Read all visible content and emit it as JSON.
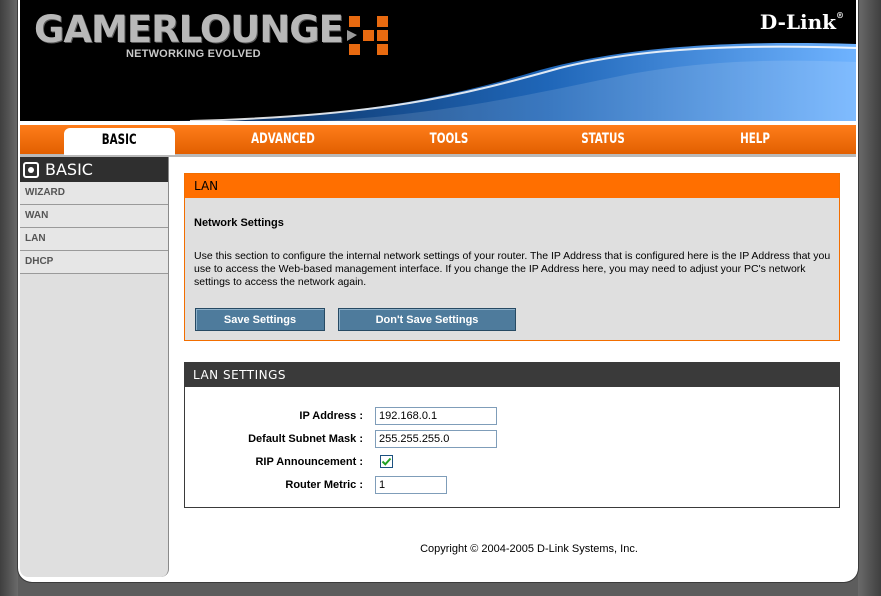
{
  "header": {
    "logo_main": "GAMERLOUNGE",
    "logo_sub": "NETWORKING EVOLVED",
    "brand": "D-Link"
  },
  "tabs": [
    {
      "label": "BASIC",
      "active": true
    },
    {
      "label": "ADVANCED",
      "active": false
    },
    {
      "label": "TOOLS",
      "active": false
    },
    {
      "label": "STATUS",
      "active": false
    },
    {
      "label": "HELP",
      "active": false
    }
  ],
  "sidebar": {
    "title": "BASIC",
    "items": [
      {
        "label": "WIZARD"
      },
      {
        "label": "WAN"
      },
      {
        "label": "LAN"
      },
      {
        "label": "DHCP"
      }
    ]
  },
  "lan_panel": {
    "title": "LAN",
    "subtitle": "Network Settings",
    "description": "Use this section to configure the internal network settings of your router. The IP Address that is configured here is the IP Address that you use to access the Web-based management interface. If you change the IP Address here, you may need to adjust your PC's network settings to access the network again.",
    "save_label": "Save Settings",
    "dont_save_label": "Don't Save Settings"
  },
  "lan_settings": {
    "title": "LAN SETTINGS",
    "ip_label": "IP Address :",
    "ip_value": "192.168.0.1",
    "mask_label": "Default Subnet Mask :",
    "mask_value": "255.255.255.0",
    "rip_label": "RIP Announcement :",
    "rip_checked": true,
    "metric_label": "Router Metric :",
    "metric_value": "1"
  },
  "footer": {
    "copyright": "Copyright © 2004-2005 D-Link Systems, Inc."
  },
  "colors": {
    "accent_orange": "#ff6f00",
    "button_blue": "#4e7b9c",
    "dark_header": "#3a3a3a"
  }
}
